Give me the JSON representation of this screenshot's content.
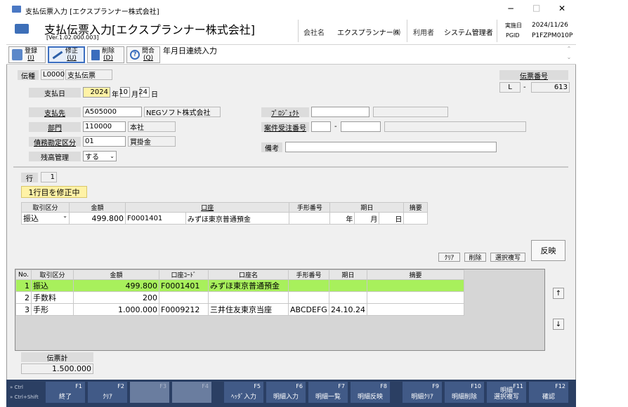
{
  "window": {
    "title": "支払伝票入力 [エクスプランナー株式会社]",
    "minimize": "−",
    "maximize": "□",
    "close": "✕"
  },
  "header": {
    "title": "支払伝票入力[エクスプランナー株式会社]",
    "version": "[Ver.1.02.000.003]",
    "company_label": "会社名",
    "company_value": "エクスプランナー㈱",
    "user_label": "利用者",
    "user_value": "システム管理者",
    "date_label": "実施日",
    "date_value": "2024/11/26",
    "pgid_label": "PGID",
    "pgid_value": "P1FZPM010P"
  },
  "toolbar": {
    "register": "登録",
    "register_key": "(I)",
    "modify": "修正",
    "modify_key": "(U)",
    "delete": "削除",
    "delete_key": "(D)",
    "inquiry": "問合",
    "inquiry_key": "(Q)",
    "memo": "年月日連続入力"
  },
  "form": {
    "slip_type_label": "伝種",
    "slip_type_code": "L0000",
    "slip_type_name": "支払伝票",
    "slip_no_label": "伝票番号",
    "slip_no_prefix": "L",
    "slip_no_dash": "-",
    "slip_no_value": "613",
    "paydate_label": "支払日",
    "year": "2024",
    "year_unit": "年",
    "month": "10",
    "month_unit": "月",
    "day": "24",
    "day_unit": "日",
    "payee_label": "支払先",
    "payee_code": "A505000",
    "payee_name": "NEGソフト株式会社",
    "project_label": "ﾌﾟﾛｼﾞｪｸﾄ",
    "dept_label": "部門",
    "dept_code": "110000",
    "dept_name": "本社",
    "order_label": "案件受注番号",
    "order_dash": "-",
    "account_label": "債務勘定区分",
    "account_code": "01",
    "account_name": "買掛金",
    "remarks_label": "備考",
    "balance_label": "残高管理",
    "balance_value": "する"
  },
  "detail": {
    "row_label": "行",
    "row_value": "1",
    "status": "1行目を修正中",
    "headers": [
      "取引区分",
      "金額",
      "口座",
      "手形番号",
      "期日",
      "摘要"
    ],
    "type_value": "振込",
    "amount_value": "499.800",
    "account_code": "F0001401",
    "account_name": "みずほ東京普通預金",
    "year_unit": "年",
    "month_unit": "月",
    "day_unit": "日",
    "clear_button": "ｸﾘｱ",
    "delete_button": "削除",
    "copy_button": "選択複写",
    "apply_button": "反映"
  },
  "table": {
    "headers": [
      "No.",
      "取引区分",
      "金額",
      "口座ｺｰﾄﾞ",
      "口座名",
      "手形番号",
      "期日",
      "摘要"
    ],
    "rows": [
      [
        "1",
        "振込",
        "499.800",
        "F0001401",
        "みずほ東京普通預金",
        "",
        "",
        ""
      ],
      [
        "2",
        "手数料",
        "200",
        "",
        "",
        "",
        "",
        ""
      ],
      [
        "3",
        "手形",
        "1.000.000",
        "F0009212",
        "三井住友東京当座",
        "ABCDEFG",
        "24.10.24",
        ""
      ]
    ],
    "up_icon": "↑",
    "down_icon": "↓"
  },
  "total": {
    "label": "伝票計",
    "value": "1.500.000"
  },
  "fkeys": {
    "ctrl": "Ctrl",
    "ctrlshift": "Ctrl+Shift",
    "keys": [
      {
        "num": "F1",
        "label": "終了"
      },
      {
        "num": "F2",
        "label": "ｸﾘｱ"
      },
      {
        "num": "F3",
        "label": ""
      },
      {
        "num": "F4",
        "label": ""
      },
      {
        "num": "F5",
        "label": "ﾍｯﾀﾞ入力"
      },
      {
        "num": "F6",
        "label": "明細入力"
      },
      {
        "num": "F7",
        "label": "明細一覧"
      },
      {
        "num": "F8",
        "label": "明細反映"
      },
      {
        "num": "F9",
        "label": "明細ｸﾘｱ"
      },
      {
        "num": "F10",
        "label": "明細削除"
      },
      {
        "num": "F11",
        "label": "明細\n選択複写"
      },
      {
        "num": "F12",
        "label": "確認"
      }
    ]
  }
}
